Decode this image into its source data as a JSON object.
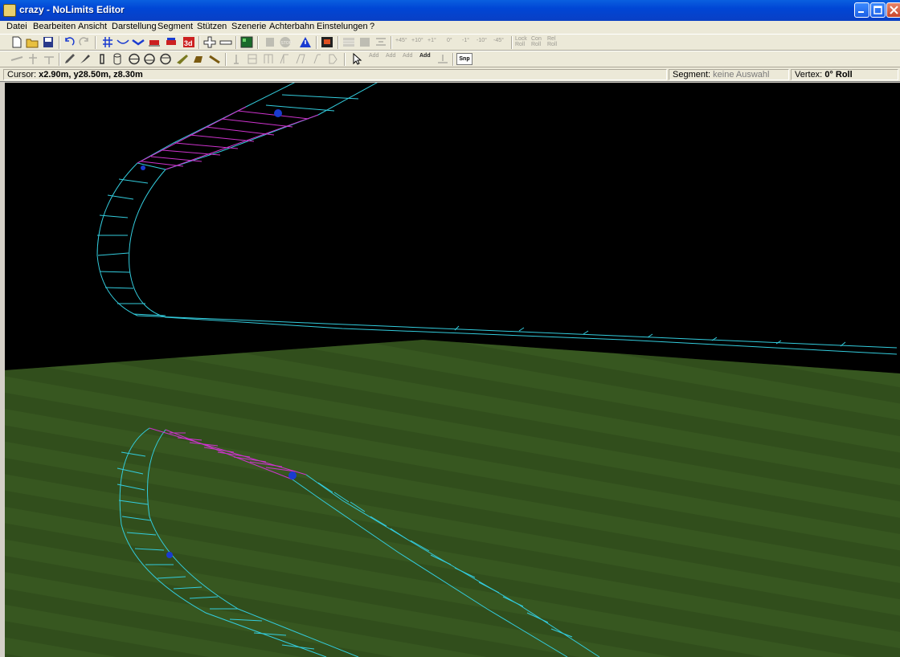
{
  "window": {
    "title": "crazy - NoLimits Editor"
  },
  "menu": [
    "Datei",
    "Bearbeiten",
    "Ansicht",
    "Darstellung",
    "Segment",
    "Stützen",
    "Szenerie",
    "Achterbahn",
    "Einstelungen",
    "?"
  ],
  "toolbar": {
    "snap_label": "Snp",
    "roll_labels": [
      "+45°",
      "+10°",
      "+1°",
      "0°",
      "-1°",
      "-10°",
      "-45°"
    ],
    "lock_labels": [
      [
        "Lock",
        "Roll"
      ],
      [
        "Con",
        "Roll"
      ],
      [
        "Rel",
        "Roll"
      ]
    ],
    "add_labels": [
      "Add",
      "Add",
      "Add",
      "Add"
    ]
  },
  "status": {
    "cursor_label": "Cursor:",
    "cursor_value": "x2.90m, y28.50m, z8.30m",
    "segment_label": "Segment:",
    "segment_value": "keine Auswahl",
    "vertex_label": "Vertex:",
    "vertex_value": "0° Roll"
  },
  "colors": {
    "track": "#33ccdd",
    "selected_segment": "#cc33cc",
    "ground": "#3a5a22",
    "sky": "#000000",
    "control_point": "#1a3bd0"
  }
}
